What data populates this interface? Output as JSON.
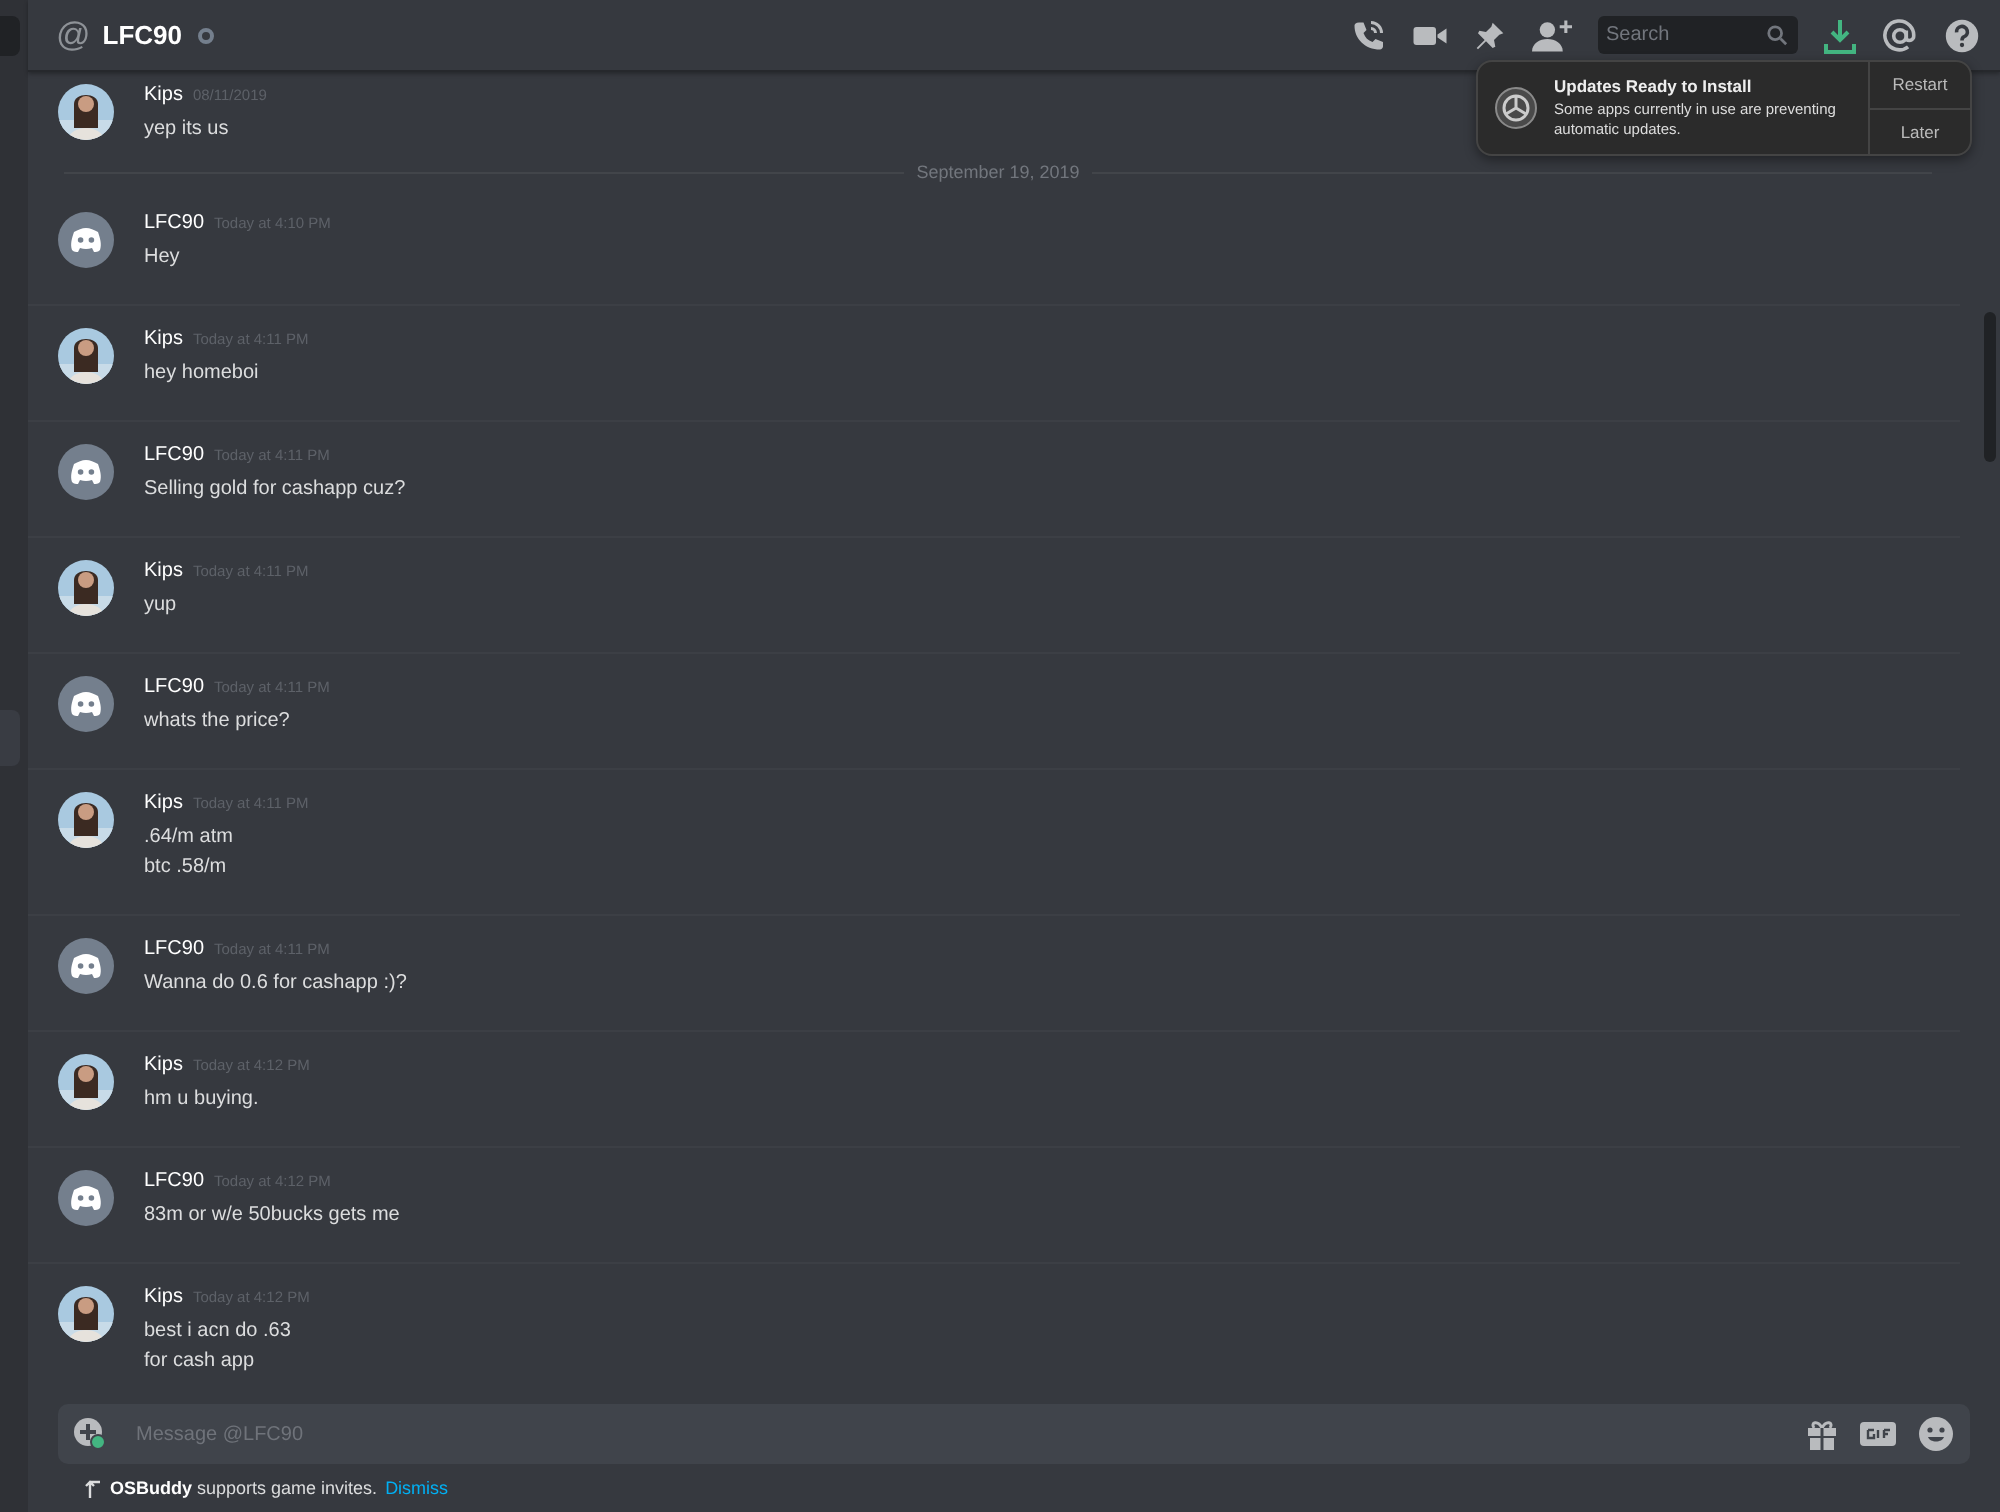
{
  "header": {
    "at_symbol": "@",
    "title": "LFC90",
    "search": {
      "placeholder": "Search"
    }
  },
  "notification": {
    "title": "Updates Ready to Install",
    "body": "Some apps currently in use are preventing automatic updates.",
    "buttons": [
      "Restart",
      "Later"
    ]
  },
  "messages": [
    {
      "author": "Kips",
      "time": "08/11/2019",
      "lines": [
        "yep its us"
      ]
    },
    {
      "kind": "divider",
      "text": "September 19, 2019"
    },
    {
      "kind": "logo",
      "author": "LFC90",
      "time": "Today at 4:10 PM",
      "lines": [
        "Hey"
      ]
    },
    {
      "author": "Kips",
      "time": "Today at 4:11 PM",
      "lines": [
        "hey homeboi"
      ]
    },
    {
      "kind": "logo",
      "author": "LFC90",
      "time": "Today at 4:11 PM",
      "lines": [
        "Selling gold for cashapp cuz?"
      ]
    },
    {
      "author": "Kips",
      "time": "Today at 4:11 PM",
      "lines": [
        "yup"
      ]
    },
    {
      "kind": "logo",
      "author": "LFC90",
      "time": "Today at 4:11 PM",
      "lines": [
        "whats the price?"
      ]
    },
    {
      "author": "Kips",
      "time": "Today at 4:11 PM",
      "lines": [
        ".64/m atm",
        "btc .58/m"
      ]
    },
    {
      "kind": "logo",
      "author": "LFC90",
      "time": "Today at 4:11 PM",
      "lines": [
        "Wanna do 0.6 for cashapp :)?"
      ]
    },
    {
      "author": "Kips",
      "time": "Today at 4:12 PM",
      "lines": [
        "hm u buying."
      ]
    },
    {
      "kind": "logo",
      "author": "LFC90",
      "time": "Today at 4:12 PM",
      "lines": [
        "83m or w/e 50bucks gets me"
      ]
    },
    {
      "author": "Kips",
      "time": "Today at 4:12 PM",
      "lines": [
        "best i acn do .63",
        "for cash app"
      ]
    }
  ],
  "composer": {
    "placeholder": "Message @LFC90"
  },
  "invite_bar": {
    "game": "OSBuddy",
    "text": "supports game invites.",
    "link": "Dismiss"
  }
}
